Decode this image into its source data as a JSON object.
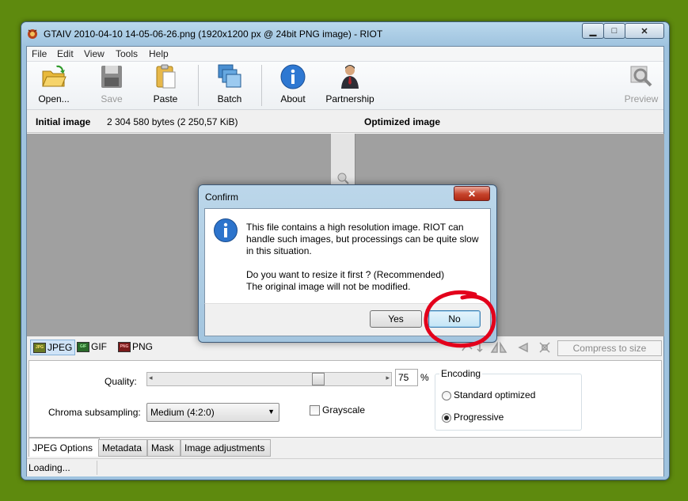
{
  "window": {
    "title": "GTAIV 2010-04-10 14-05-06-26.png (1920x1200 px @ 24bit PNG image) - RIOT"
  },
  "menu": [
    "File",
    "Edit",
    "View",
    "Tools",
    "Help"
  ],
  "toolbar": {
    "open": "Open...",
    "save": "Save",
    "paste": "Paste",
    "batch": "Batch",
    "about": "About",
    "partnership": "Partnership",
    "preview": "Preview"
  },
  "header": {
    "initial_label": "Initial image",
    "initial_size": "2 304 580 bytes (2 250,57 KiB)",
    "optimized_label": "Optimized image"
  },
  "formats": {
    "jpeg": "JPEG",
    "gif": "GIF",
    "png": "PNG",
    "compress": "Compress to size"
  },
  "options": {
    "quality_label": "Quality:",
    "quality_value": "75",
    "percent": "%",
    "chroma_label": "Chroma subsampling:",
    "chroma_value": "Medium (4:2:0)",
    "grayscale": "Grayscale",
    "encoding_legend": "Encoding",
    "encoding_options": [
      "Standard optimized",
      "Progressive"
    ],
    "encoding_selected": "Progressive"
  },
  "tabs": [
    "JPEG Options",
    "Metadata",
    "Mask",
    "Image adjustments"
  ],
  "status": "Loading...",
  "dialog": {
    "title": "Confirm",
    "message": "This file contains a high resolution image. RIOT can handle such images, but processings can be quite slow in this situation.",
    "question": "Do you want to resize it first ? (Recommended)",
    "note": "The original image will not be modified.",
    "yes": "Yes",
    "no": "No"
  },
  "colors": {
    "desktop": "#5e8a0e",
    "highlight_circle": "#e3001b",
    "title_bar": "#9fc3df"
  }
}
